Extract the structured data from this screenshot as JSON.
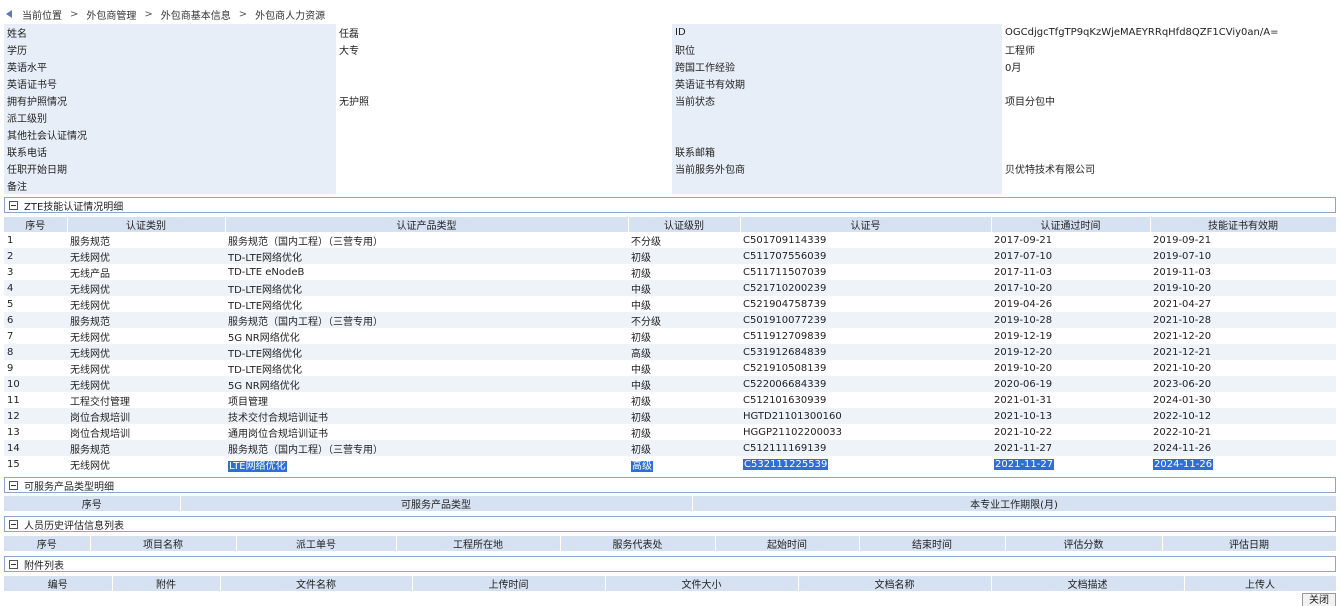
{
  "breadcrumb": [
    "当前位置",
    "外包商管理",
    "外包商基本信息",
    "外包商人力资源"
  ],
  "info": {
    "rows": [
      [
        {
          "l": "姓名",
          "v": "任磊"
        },
        {
          "l": "ID",
          "v": "OGCdjgcTfgTP9qKzWjeMAEYRRqHfd8QZF1CViy0an/A="
        }
      ],
      [
        {
          "l": "学历",
          "v": "大专"
        },
        {
          "l": "职位",
          "v": "工程师"
        }
      ],
      [
        {
          "l": "英语水平",
          "v": ""
        },
        {
          "l": "跨国工作经验",
          "v": "0月"
        }
      ],
      [
        {
          "l": "英语证书号",
          "v": ""
        },
        {
          "l": "英语证书有效期",
          "v": ""
        }
      ],
      [
        {
          "l": "拥有护照情况",
          "v": "无护照"
        },
        {
          "l": "当前状态",
          "v": "项目分包中"
        }
      ],
      [
        {
          "l": "派工级别",
          "v": ""
        },
        {
          "l": "",
          "v": ""
        }
      ],
      [
        {
          "l": "其他社会认证情况",
          "v": ""
        },
        {
          "l": "",
          "v": ""
        }
      ],
      [
        {
          "l": "联系电话",
          "v": ""
        },
        {
          "l": "联系邮箱",
          "v": ""
        }
      ],
      [
        {
          "l": "任职开始日期",
          "v": ""
        },
        {
          "l": "当前服务外包商",
          "v": "贝优特技术有限公司"
        }
      ],
      [
        {
          "l": "备注",
          "v": ""
        },
        {
          "l": "",
          "v": ""
        }
      ]
    ]
  },
  "zte": {
    "title": "ZTE技能认证情况明细",
    "columns": [
      "序号",
      "认证类别",
      "认证产品类型",
      "认证级别",
      "认证号",
      "认证通过时间",
      "技能证书有效期"
    ],
    "rows": [
      [
        "1",
        "服务规范",
        "服务规范（国内工程）（三营专用）",
        "不分级",
        "C501709114339",
        "2017-09-21",
        "2019-09-21"
      ],
      [
        "2",
        "无线网优",
        "TD-LTE网络优化",
        "初级",
        "C511707556039",
        "2017-07-10",
        "2019-07-10"
      ],
      [
        "3",
        "无线产品",
        "TD-LTE eNodeB",
        "初级",
        "C511711507039",
        "2017-11-03",
        "2019-11-03"
      ],
      [
        "4",
        "无线网优",
        "TD-LTE网络优化",
        "中级",
        "C521710200239",
        "2017-10-20",
        "2019-10-20"
      ],
      [
        "5",
        "无线网优",
        "TD-LTE网络优化",
        "中级",
        "C521904758739",
        "2019-04-26",
        "2021-04-27"
      ],
      [
        "6",
        "服务规范",
        "服务规范（国内工程）（三营专用）",
        "不分级",
        "C501910077239",
        "2019-10-28",
        "2021-10-28"
      ],
      [
        "7",
        "无线网优",
        "5G NR网络优化",
        "初级",
        "C511912709839",
        "2019-12-19",
        "2021-12-20"
      ],
      [
        "8",
        "无线网优",
        "TD-LTE网络优化",
        "高级",
        "C531912684839",
        "2019-12-20",
        "2021-12-21"
      ],
      [
        "9",
        "无线网优",
        "TD-LTE网络优化",
        "中级",
        "C521910508139",
        "2019-10-20",
        "2021-10-20"
      ],
      [
        "10",
        "无线网优",
        "5G NR网络优化",
        "中级",
        "C522006684339",
        "2020-06-19",
        "2023-06-20"
      ],
      [
        "11",
        "工程交付管理",
        "项目管理",
        "初级",
        "C512101630939",
        "2021-01-31",
        "2024-01-30"
      ],
      [
        "12",
        "岗位合规培训",
        "技术交付合规培训证书",
        "初级",
        "HGTD21101300160",
        "2021-10-13",
        "2022-10-12"
      ],
      [
        "13",
        "岗位合规培训",
        "通用岗位合规培训证书",
        "初级",
        "HGGP21102200033",
        "2021-10-22",
        "2022-10-21"
      ],
      [
        "14",
        "服务规范",
        "服务规范（国内工程）（三营专用）",
        "初级",
        "C512111169139",
        "2021-11-27",
        "2024-11-26"
      ],
      [
        "15",
        "无线网优",
        "LTE网络优化",
        "高级",
        "C532111225539",
        "2021-11-27",
        "2024-11-26"
      ]
    ]
  },
  "products": {
    "title": "可服务产品类型明细",
    "columns": [
      "序号",
      "可服务产品类型",
      "本专业工作期限(月)"
    ]
  },
  "history": {
    "title": "人员历史评估信息列表",
    "columns": [
      "序号",
      "项目名称",
      "派工单号",
      "工程所在地",
      "服务代表处",
      "起始时间",
      "结束时间",
      "评估分数",
      "评估日期"
    ]
  },
  "attachments": {
    "title": "附件列表",
    "columns": [
      "编号",
      "附件",
      "文件名称",
      "上传时间",
      "文件大小",
      "文档名称",
      "文档描述",
      "上传人"
    ]
  },
  "close_label": "关闭",
  "colors": {
    "label_bg": "#e8eef7",
    "header_bg": "#d6e1f1",
    "highlight": "#2d6fd6"
  }
}
